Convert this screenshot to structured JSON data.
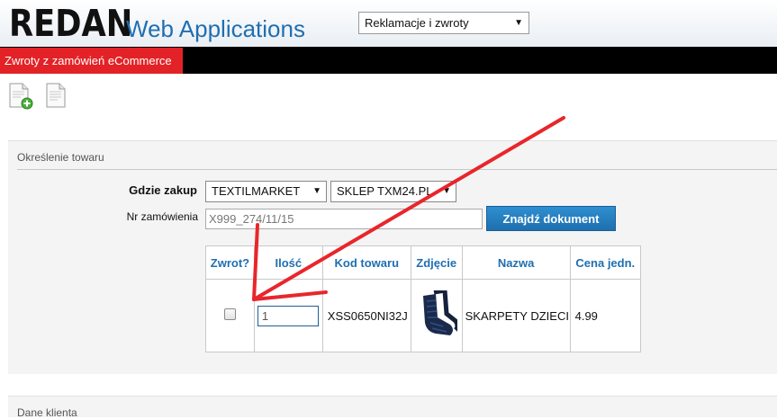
{
  "header": {
    "logo_main": "REDAN",
    "logo_sub": "Web Applications",
    "module_select": {
      "value": "Reklamacje i zwroty"
    }
  },
  "menu": {
    "active_item": "Zwroty z zamówień eCommerce"
  },
  "toolbar": {
    "icons": [
      "new-document-icon",
      "document-icon"
    ]
  },
  "section_product": {
    "title": "Określenie towaru",
    "where_label": "Gdzie zakup",
    "where_value": "TEXTILMARKET",
    "store_value": "SKLEP TXM24.PL",
    "order_label": "Nr zamówienia",
    "order_value": "X999_274/11/15",
    "find_button": "Znajdź dokument",
    "table": {
      "headers": [
        "Zwrot?",
        "Ilość",
        "Kod towaru",
        "Zdjęcie",
        "Nazwa",
        "Cena jedn."
      ],
      "rows": [
        {
          "returned": false,
          "qty": "1",
          "code": "XSS0650NI32J",
          "photo": "sock-image",
          "name": "SKARPETY DZIECIĘ",
          "price": "4.99"
        }
      ]
    }
  },
  "section_client": {
    "title": "Dane klienta"
  },
  "colors": {
    "menu_bg": "#000000",
    "menu_active": "#e32227",
    "accent_blue": "#1f6fb1",
    "annotation_red": "#e8262b"
  }
}
